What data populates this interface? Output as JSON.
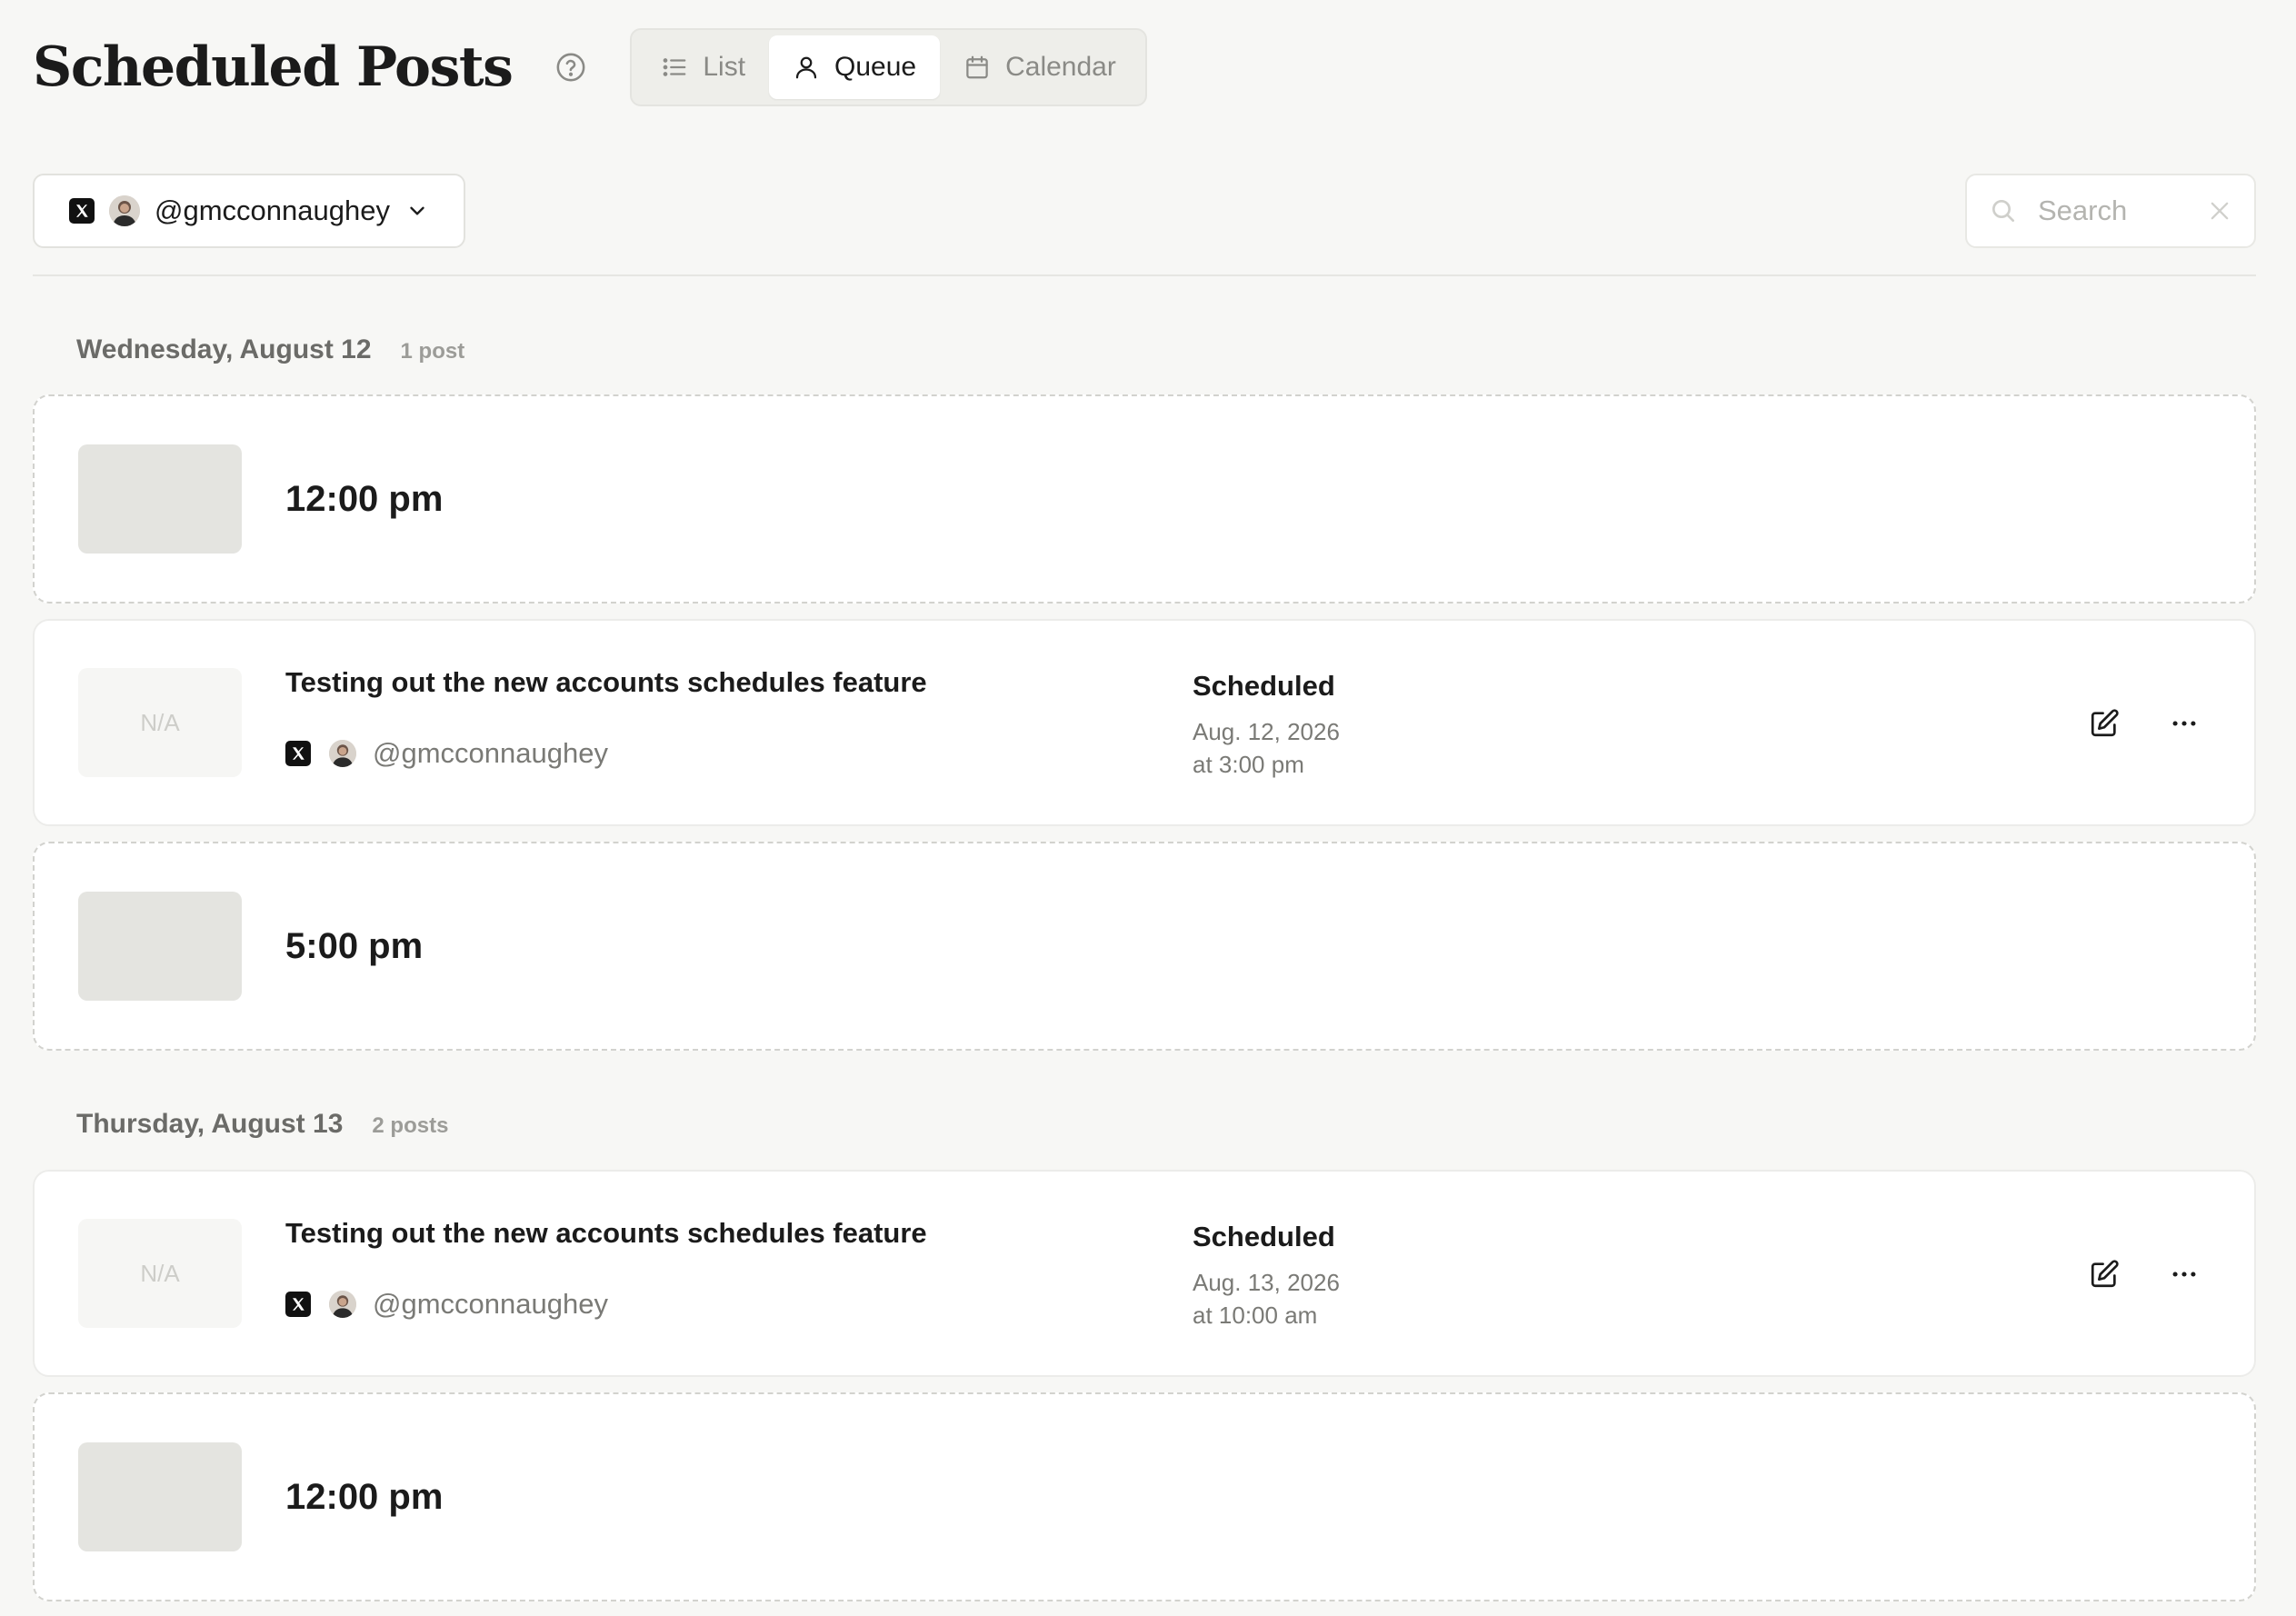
{
  "header": {
    "title": "Scheduled Posts",
    "help_icon": "help-circle-icon",
    "views": [
      {
        "label": "List",
        "icon": "list-icon",
        "active": false
      },
      {
        "label": "Queue",
        "icon": "person-icon",
        "active": true
      },
      {
        "label": "Calendar",
        "icon": "calendar-icon",
        "active": false
      }
    ]
  },
  "toolbar": {
    "account_handle": "@gmcconnaughey",
    "search": {
      "placeholder": "Search",
      "value": ""
    }
  },
  "days": [
    {
      "title": "Wednesday, August 12",
      "count": "1 post",
      "entries": [
        {
          "kind": "slot",
          "time": "12:00 pm"
        },
        {
          "kind": "post",
          "thumb": "N/A",
          "text": "Testing out the new accounts schedules feature",
          "handle": "@gmcconnaughey",
          "status": "Scheduled",
          "date": "Aug. 12, 2026",
          "time": "at 3:00 pm"
        },
        {
          "kind": "slot",
          "time": "5:00 pm"
        }
      ]
    },
    {
      "title": "Thursday, August 13",
      "count": "2 posts",
      "entries": [
        {
          "kind": "post",
          "thumb": "N/A",
          "text": "Testing out the new accounts schedules feature",
          "handle": "@gmcconnaughey",
          "status": "Scheduled",
          "date": "Aug. 13, 2026",
          "time": "at 10:00 am"
        },
        {
          "kind": "slot",
          "time": "12:00 pm"
        }
      ]
    }
  ],
  "colors": {
    "background": "#f7f7f5",
    "card": "#ffffff",
    "slot_border": "#d2d2ce",
    "muted_text": "#7a7a76"
  }
}
